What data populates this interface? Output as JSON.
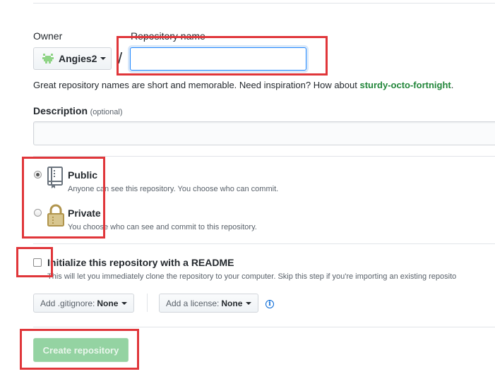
{
  "owner": {
    "label": "Owner",
    "selected": "Angies2",
    "separator": "/"
  },
  "repository_name": {
    "label": "Repository name",
    "value": ""
  },
  "hint": {
    "text": "Great repository names are short and memorable. Need inspiration? How about ",
    "suggestion": "sturdy-octo-fortnight",
    "end": "."
  },
  "description": {
    "label": "Description",
    "optional": "(optional)",
    "value": ""
  },
  "visibility": {
    "public": {
      "title": "Public",
      "note": "Anyone can see this repository. You choose who can commit.",
      "selected": true,
      "icon": "repo-book-icon"
    },
    "private": {
      "title": "Private",
      "note": "You choose who can see and commit to this repository.",
      "selected": false,
      "icon": "lock-icon"
    }
  },
  "readme": {
    "label": "Initialize this repository with a README",
    "note": "This will let you immediately clone the repository to your computer. Skip this step if you're importing an existing reposito",
    "checked": false
  },
  "gitignore": {
    "prefix": "Add .gitignore:",
    "value": "None"
  },
  "license": {
    "prefix": "Add a license:",
    "value": "None"
  },
  "submit": {
    "label": "Create repository"
  },
  "colors": {
    "highlight": "#e0363a",
    "create_button": "#94d3a2",
    "suggestion": "#22863a",
    "focus": "#2188ff"
  }
}
